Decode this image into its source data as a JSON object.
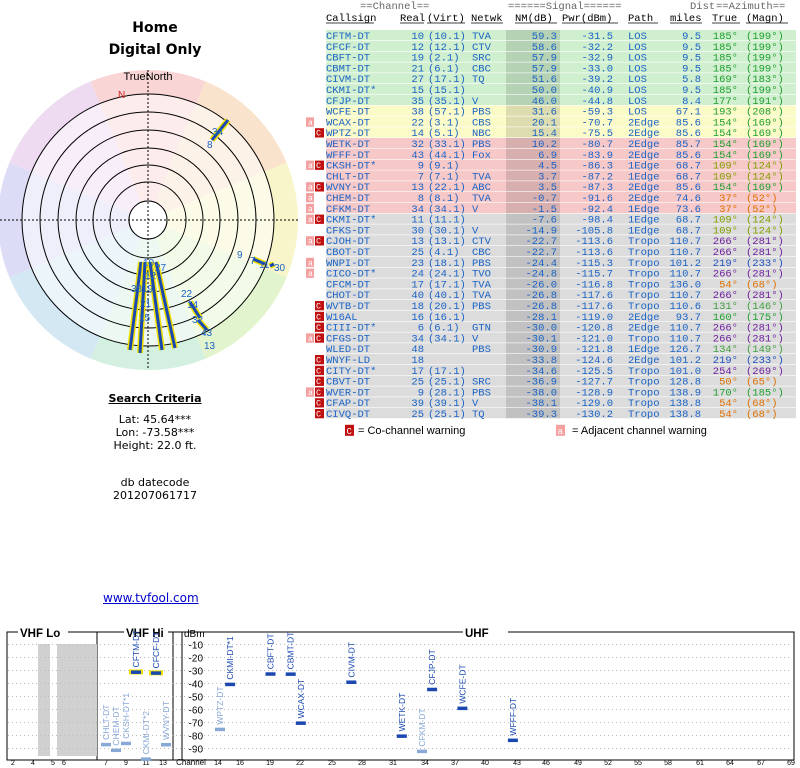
{
  "report": {
    "title": "Home",
    "subtitle": "Digital Only",
    "true_north_label": "TrueNorth",
    "north_marker": "N",
    "criteria_title": "Search Criteria",
    "lat": "Lat: 45.64***",
    "lon": "Lon: -73.58***",
    "height": "Height: 22.0 ft.",
    "db_label": "db datecode",
    "db_value": "201207061717",
    "link": "www.tvfool.com"
  },
  "headers": {
    "group_channel": "==Channel==",
    "group_signal": "======Signal======",
    "group_dist": "Dist",
    "group_azimuth": "==Azimuth==",
    "callsign": "Callsign",
    "real": "Real",
    "virt": "(Virt)",
    "netwk": "Netwk",
    "nm": "NM(dB)",
    "pwr": "Pwr(dBm)",
    "path": "Path",
    "miles": "miles",
    "true": "True",
    "magn": "(Magn)"
  },
  "legend": {
    "cochannel_icon": "C",
    "cochannel": "= Co-channel warning",
    "adjacent_icon": "a",
    "adjacent": "= Adjacent channel warning"
  },
  "band_colors": {
    "green": "#cfefcf",
    "yellow": "#fbfbc8",
    "red": "#f6c8c8",
    "gray": "#dcdcdc",
    "text_blue": "#1a63c6"
  },
  "stations": [
    {
      "call": "CFTM-DT",
      "real": "10",
      "virt": "(10.1)",
      "net": "TVA",
      "nm": "59.3",
      "pwr": "-31.5",
      "path": "LOS",
      "dist": "9.5",
      "az": "185°",
      "mag": "(199°)",
      "band": "green",
      "azc": "#20a030",
      "warn": ""
    },
    {
      "call": "CFCF-DT",
      "real": "12",
      "virt": "(12.1)",
      "net": "CTV",
      "nm": "58.6",
      "pwr": "-32.2",
      "path": "LOS",
      "dist": "9.5",
      "az": "185°",
      "mag": "(199°)",
      "band": "green",
      "azc": "#20a030",
      "warn": ""
    },
    {
      "call": "CBFT-DT",
      "real": "19",
      "virt": "(2.1)",
      "net": "SRC",
      "nm": "57.9",
      "pwr": "-32.9",
      "path": "LOS",
      "dist": "9.5",
      "az": "185°",
      "mag": "(199°)",
      "band": "green",
      "azc": "#20a030",
      "warn": ""
    },
    {
      "call": "CBMT-DT",
      "real": "21",
      "virt": "(6.1)",
      "net": "CBC",
      "nm": "57.9",
      "pwr": "-33.0",
      "path": "LOS",
      "dist": "9.5",
      "az": "185°",
      "mag": "(199°)",
      "band": "green",
      "azc": "#20a030",
      "warn": ""
    },
    {
      "call": "CIVM-DT",
      "real": "27",
      "virt": "(17.1)",
      "net": "TQ",
      "nm": "51.6",
      "pwr": "-39.2",
      "path": "LOS",
      "dist": "5.8",
      "az": "169°",
      "mag": "(183°)",
      "band": "green",
      "azc": "#20a030",
      "warn": ""
    },
    {
      "call": "CKMI-DT*",
      "real": "15",
      "virt": "(15.1)",
      "net": "",
      "nm": "50.0",
      "pwr": "-40.9",
      "path": "LOS",
      "dist": "9.5",
      "az": "185°",
      "mag": "(199°)",
      "band": "green",
      "azc": "#20a030",
      "warn": ""
    },
    {
      "call": "CFJP-DT",
      "real": "35",
      "virt": "(35.1)",
      "net": "V",
      "nm": "46.0",
      "pwr": "-44.8",
      "path": "LOS",
      "dist": "8.4",
      "az": "177°",
      "mag": "(191°)",
      "band": "green",
      "azc": "#20a030",
      "warn": ""
    },
    {
      "call": "WCFE-DT",
      "real": "38",
      "virt": "(57.1)",
      "net": "PBS",
      "nm": "31.6",
      "pwr": "-59.3",
      "path": "LOS",
      "dist": "67.1",
      "az": "193°",
      "mag": "(208°)",
      "band": "yellow",
      "azc": "#20a030",
      "warn": ""
    },
    {
      "call": "WCAX-DT",
      "real": "22",
      "virt": "(3.1)",
      "net": "CBS",
      "nm": "20.1",
      "pwr": "-70.7",
      "path": "2Edge",
      "dist": "85.6",
      "az": "154°",
      "mag": "(169°)",
      "band": "yellow",
      "azc": "#20a030",
      "warn": "a"
    },
    {
      "call": "WPTZ-DT",
      "real": "14",
      "virt": "(5.1)",
      "net": "NBC",
      "nm": "15.4",
      "pwr": "-75.5",
      "path": "2Edge",
      "dist": "85.6",
      "az": "154°",
      "mag": "(169°)",
      "band": "yellow",
      "azc": "#20a030",
      "warn": "C"
    },
    {
      "call": "WETK-DT",
      "real": "32",
      "virt": "(33.1)",
      "net": "PBS",
      "nm": "10.2",
      "pwr": "-80.7",
      "path": "2Edge",
      "dist": "85.7",
      "az": "154°",
      "mag": "(169°)",
      "band": "red",
      "azc": "#20a030",
      "warn": ""
    },
    {
      "call": "WFFF-DT",
      "real": "43",
      "virt": "(44.1)",
      "net": "Fox",
      "nm": "6.9",
      "pwr": "-83.9",
      "path": "2Edge",
      "dist": "85.6",
      "az": "154°",
      "mag": "(169°)",
      "band": "red",
      "azc": "#20a030",
      "warn": ""
    },
    {
      "call": "CKSH-DT*",
      "real": "9",
      "virt": "(9.1)",
      "net": "",
      "nm": "4.5",
      "pwr": "-86.3",
      "path": "1Edge",
      "dist": "68.7",
      "az": "109°",
      "mag": "(124°)",
      "band": "red",
      "azc": "#80a000",
      "warn": "aC"
    },
    {
      "call": "CHLT-DT",
      "real": "7",
      "virt": "(7.1)",
      "net": "TVA",
      "nm": "3.7",
      "pwr": "-87.2",
      "path": "1Edge",
      "dist": "68.7",
      "az": "109°",
      "mag": "(124°)",
      "band": "red",
      "azc": "#80a000",
      "warn": ""
    },
    {
      "call": "WVNY-DT",
      "real": "13",
      "virt": "(22.1)",
      "net": "ABC",
      "nm": "3.5",
      "pwr": "-87.3",
      "path": "2Edge",
      "dist": "85.6",
      "az": "154°",
      "mag": "(169°)",
      "band": "red",
      "azc": "#20a030",
      "warn": "aC"
    },
    {
      "call": "CHEM-DT",
      "real": "8",
      "virt": "(8.1)",
      "net": "TVA",
      "nm": "-0.7",
      "pwr": "-91.6",
      "path": "2Edge",
      "dist": "74.6",
      "az": "37°",
      "mag": "(52°)",
      "band": "red",
      "azc": "#e07000",
      "warn": "a"
    },
    {
      "call": "CFKM-DT",
      "real": "34",
      "virt": "(34.1)",
      "net": "V",
      "nm": "-1.5",
      "pwr": "-92.4",
      "path": "1Edge",
      "dist": "73.6",
      "az": "37°",
      "mag": "(52°)",
      "band": "red",
      "azc": "#e07000",
      "warn": "a"
    },
    {
      "call": "CKMI-DT*",
      "real": "11",
      "virt": "(11.1)",
      "net": "",
      "nm": "-7.6",
      "pwr": "-98.4",
      "path": "1Edge",
      "dist": "68.7",
      "az": "109°",
      "mag": "(124°)",
      "band": "gray",
      "azc": "#80a000",
      "warn": "aC"
    },
    {
      "call": "CFKS-DT",
      "real": "30",
      "virt": "(30.1)",
      "net": "V",
      "nm": "-14.9",
      "pwr": "-105.8",
      "path": "1Edge",
      "dist": "68.7",
      "az": "109°",
      "mag": "(124°)",
      "band": "gray",
      "azc": "#80a000",
      "warn": ""
    },
    {
      "call": "CJOH-DT",
      "real": "13",
      "virt": "(13.1)",
      "net": "CTV",
      "nm": "-22.7",
      "pwr": "-113.6",
      "path": "Tropo",
      "dist": "110.7",
      "az": "266°",
      "mag": "(281°)",
      "band": "gray",
      "azc": "#7020a0",
      "warn": "aC"
    },
    {
      "call": "CBOT-DT",
      "real": "25",
      "virt": "(4.1)",
      "net": "CBC",
      "nm": "-22.7",
      "pwr": "-113.6",
      "path": "Tropo",
      "dist": "110.7",
      "az": "266°",
      "mag": "(281°)",
      "band": "gray",
      "azc": "#7020a0",
      "warn": ""
    },
    {
      "call": "WNPI-DT",
      "real": "23",
      "virt": "(18.1)",
      "net": "PBS",
      "nm": "-24.4",
      "pwr": "-115.3",
      "path": "Tropo",
      "dist": "101.2",
      "az": "219°",
      "mag": "(233°)",
      "band": "gray",
      "azc": "#2050c0",
      "warn": "a"
    },
    {
      "call": "CICO-DT*",
      "real": "24",
      "virt": "(24.1)",
      "net": "TVO",
      "nm": "-24.8",
      "pwr": "-115.7",
      "path": "Tropo",
      "dist": "110.7",
      "az": "266°",
      "mag": "(281°)",
      "band": "gray",
      "azc": "#7020a0",
      "warn": "a"
    },
    {
      "call": "CFCM-DT",
      "real": "17",
      "virt": "(17.1)",
      "net": "TVA",
      "nm": "-26.0",
      "pwr": "-116.8",
      "path": "Tropo",
      "dist": "136.0",
      "az": "54°",
      "mag": "(68°)",
      "band": "gray",
      "azc": "#e07000",
      "warn": ""
    },
    {
      "call": "CHOT-DT",
      "real": "40",
      "virt": "(40.1)",
      "net": "TVA",
      "nm": "-26.8",
      "pwr": "-117.6",
      "path": "Tropo",
      "dist": "110.7",
      "az": "266°",
      "mag": "(281°)",
      "band": "gray",
      "azc": "#7020a0",
      "warn": ""
    },
    {
      "call": "WVTB-DT",
      "real": "18",
      "virt": "(20.1)",
      "net": "PBS",
      "nm": "-26.8",
      "pwr": "-117.6",
      "path": "Tropo",
      "dist": "110.6",
      "az": "131°",
      "mag": "(146°)",
      "band": "gray",
      "azc": "#40a040",
      "warn": "C"
    },
    {
      "call": "W16AL",
      "real": "16",
      "virt": "(16.1)",
      "net": "",
      "nm": "-28.1",
      "pwr": "-119.0",
      "path": "2Edge",
      "dist": "93.7",
      "az": "160°",
      "mag": "(175°)",
      "band": "gray",
      "azc": "#20a030",
      "warn": "C"
    },
    {
      "call": "CIII-DT*",
      "real": "6",
      "virt": "(6.1)",
      "net": "GTN",
      "nm": "-30.0",
      "pwr": "-120.8",
      "path": "2Edge",
      "dist": "110.7",
      "az": "266°",
      "mag": "(281°)",
      "band": "gray",
      "azc": "#7020a0",
      "warn": "C"
    },
    {
      "call": "CFGS-DT",
      "real": "34",
      "virt": "(34.1)",
      "net": "V",
      "nm": "-30.1",
      "pwr": "-121.0",
      "path": "Tropo",
      "dist": "110.7",
      "az": "266°",
      "mag": "(281°)",
      "band": "gray",
      "azc": "#7020a0",
      "warn": "aC"
    },
    {
      "call": "WLED-DT",
      "real": "48",
      "virt": "",
      "net": "PBS",
      "nm": "-30.9",
      "pwr": "-121.8",
      "path": "1Edge",
      "dist": "126.7",
      "az": "134°",
      "mag": "(149°)",
      "band": "gray",
      "azc": "#40a040",
      "warn": ""
    },
    {
      "call": "WNYF-LD",
      "real": "18",
      "virt": "",
      "net": "",
      "nm": "-33.8",
      "pwr": "-124.6",
      "path": "2Edge",
      "dist": "101.2",
      "az": "219°",
      "mag": "(233°)",
      "band": "gray",
      "azc": "#2050c0",
      "warn": "C"
    },
    {
      "call": "CITY-DT*",
      "real": "17",
      "virt": "(17.1)",
      "net": "",
      "nm": "-34.6",
      "pwr": "-125.5",
      "path": "Tropo",
      "dist": "101.0",
      "az": "254°",
      "mag": "(269°)",
      "band": "gray",
      "azc": "#7020a0",
      "warn": "C"
    },
    {
      "call": "CBVT-DT",
      "real": "25",
      "virt": "(25.1)",
      "net": "SRC",
      "nm": "-36.9",
      "pwr": "-127.7",
      "path": "Tropo",
      "dist": "128.8",
      "az": "50°",
      "mag": "(65°)",
      "band": "gray",
      "azc": "#e07000",
      "warn": "C"
    },
    {
      "call": "WVER-DT",
      "real": "9",
      "virt": "(28.1)",
      "net": "PBS",
      "nm": "-38.0",
      "pwr": "-128.9",
      "path": "Tropo",
      "dist": "138.9",
      "az": "170°",
      "mag": "(185°)",
      "band": "gray",
      "azc": "#20a030",
      "warn": "aC"
    },
    {
      "call": "CFAP-DT",
      "real": "39",
      "virt": "(39.1)",
      "net": "V",
      "nm": "-38.1",
      "pwr": "-129.0",
      "path": "Tropo",
      "dist": "138.8",
      "az": "54°",
      "mag": "(68°)",
      "band": "gray",
      "azc": "#e07000",
      "warn": "C"
    },
    {
      "call": "CIVQ-DT",
      "real": "25",
      "virt": "(25.1)",
      "net": "TQ",
      "nm": "-39.3",
      "pwr": "-130.2",
      "path": "Tropo",
      "dist": "138.8",
      "az": "54°",
      "mag": "(68°)",
      "band": "gray",
      "azc": "#e07000",
      "warn": "C"
    }
  ],
  "polar": {
    "labels": [
      {
        "text": "34",
        "color": "#1a63c6"
      },
      {
        "text": "8",
        "color": "#1a63c6"
      },
      {
        "text": "10",
        "color": "#1a63c6"
      },
      {
        "text": "27",
        "color": "#1a63c6"
      },
      {
        "text": "12",
        "color": "#1a63c6"
      },
      {
        "text": "9",
        "color": "#1a63c6"
      },
      {
        "text": "7",
        "color": "#1a63c6"
      },
      {
        "text": "11",
        "color": "#1a63c6"
      },
      {
        "text": "30",
        "color": "#1a63c6"
      },
      {
        "text": "38",
        "color": "#1a63c6"
      },
      {
        "text": "19",
        "color": "#1a63c6"
      },
      {
        "text": "21",
        "color": "#1a63c6"
      },
      {
        "text": "15",
        "color": "#1a63c6"
      },
      {
        "text": "22",
        "color": "#1a63c6"
      },
      {
        "text": "14",
        "color": "#1a63c6"
      },
      {
        "text": "32",
        "color": "#1a63c6"
      },
      {
        "text": "43",
        "color": "#1a63c6"
      },
      {
        "text": "13",
        "color": "#1a63c6"
      }
    ]
  },
  "chart_data": {
    "type": "bar",
    "title": "",
    "sections": [
      "VHF Lo",
      "VHF Hi",
      "UHF"
    ],
    "ylabel": "dBm",
    "yticks": [
      "-10",
      "-20",
      "-30",
      "-40",
      "-50",
      "-60",
      "-70",
      "-80",
      "-90"
    ],
    "ylim": [
      -95,
      -5
    ],
    "xlabel": "Channel",
    "xticks": [
      "2",
      "4",
      "5",
      "6",
      "7",
      "9",
      "11",
      "13",
      "14",
      "16",
      "19",
      "22",
      "25",
      "28",
      "31",
      "34",
      "37",
      "40",
      "43",
      "46",
      "49",
      "52",
      "55",
      "58",
      "61",
      "64",
      "67",
      "69"
    ],
    "series": [
      {
        "call": "CHLT-DT",
        "ch": 7,
        "dbm": -87.2,
        "strong": false
      },
      {
        "call": "CHEM-DT",
        "ch": 8,
        "dbm": -91.6,
        "strong": false
      },
      {
        "call": "CKSH-DT*1",
        "ch": 9,
        "dbm": -86.3,
        "strong": false
      },
      {
        "call": "CFTM-DT",
        "ch": 10,
        "dbm": -31.5,
        "strong": true
      },
      {
        "call": "CKMI-DT*2",
        "ch": 11,
        "dbm": -98.4,
        "strong": false
      },
      {
        "call": "CFCF-DT",
        "ch": 12,
        "dbm": -32.2,
        "strong": true
      },
      {
        "call": "WVNY-DT",
        "ch": 13,
        "dbm": -87.3,
        "strong": false
      },
      {
        "call": "WPTZ-DT",
        "ch": 14,
        "dbm": -75.5,
        "strong": false
      },
      {
        "call": "CKMI-DT*1",
        "ch": 15,
        "dbm": -40.9,
        "strong": true
      },
      {
        "call": "CBFT-DT",
        "ch": 19,
        "dbm": -32.9,
        "strong": true
      },
      {
        "call": "CBMT-DT",
        "ch": 21,
        "dbm": -33.0,
        "strong": true
      },
      {
        "call": "WCAX-DT",
        "ch": 22,
        "dbm": -70.7,
        "strong": true
      },
      {
        "call": "CIVM-DT",
        "ch": 27,
        "dbm": -39.2,
        "strong": true
      },
      {
        "call": "WETK-DT",
        "ch": 32,
        "dbm": -80.7,
        "strong": true
      },
      {
        "call": "CFKM-DT",
        "ch": 34,
        "dbm": -92.4,
        "strong": false
      },
      {
        "call": "CFJP-DT",
        "ch": 35,
        "dbm": -44.8,
        "strong": true
      },
      {
        "call": "WCFE-DT",
        "ch": 38,
        "dbm": -59.3,
        "strong": true
      },
      {
        "call": "WFFF-DT",
        "ch": 43,
        "dbm": -83.9,
        "strong": true
      }
    ]
  }
}
